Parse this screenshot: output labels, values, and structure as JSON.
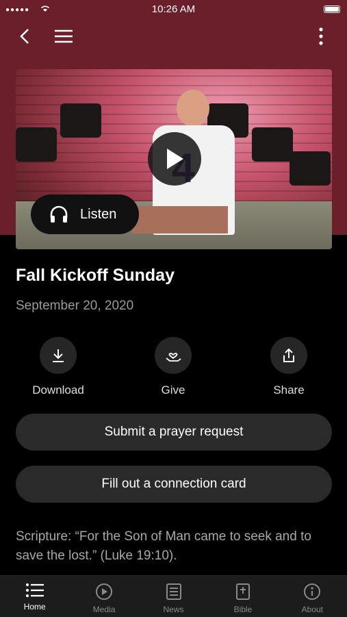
{
  "status": {
    "time": "10:26 AM"
  },
  "nav": {
    "back_icon": "chevron-left-icon",
    "menu_icon": "hamburger-icon",
    "more_icon": "more-vertical-icon"
  },
  "media": {
    "listen_label": "Listen"
  },
  "sermon": {
    "title": "Fall Kickoff Sunday",
    "date": "September 20, 2020"
  },
  "actions": [
    {
      "label": "Download",
      "icon": "download-icon"
    },
    {
      "label": "Give",
      "icon": "give-heart-hand-icon"
    },
    {
      "label": "Share",
      "icon": "share-icon"
    }
  ],
  "buttons": {
    "prayer": "Submit a prayer request",
    "connection": "Fill out a connection card"
  },
  "scripture": "Scripture: “For the Son of Man came to seek and to save the lost.”  (Luke 19:10).",
  "tabs": [
    {
      "label": "Home",
      "icon": "home-list-icon",
      "active": true
    },
    {
      "label": "Media",
      "icon": "media-play-icon",
      "active": false
    },
    {
      "label": "News",
      "icon": "news-icon",
      "active": false
    },
    {
      "label": "Bible",
      "icon": "bible-icon",
      "active": false
    },
    {
      "label": "About",
      "icon": "info-icon",
      "active": false
    }
  ],
  "colors": {
    "header": "#6b1f2b",
    "background": "#000000",
    "pill": "#2a2a2a"
  }
}
